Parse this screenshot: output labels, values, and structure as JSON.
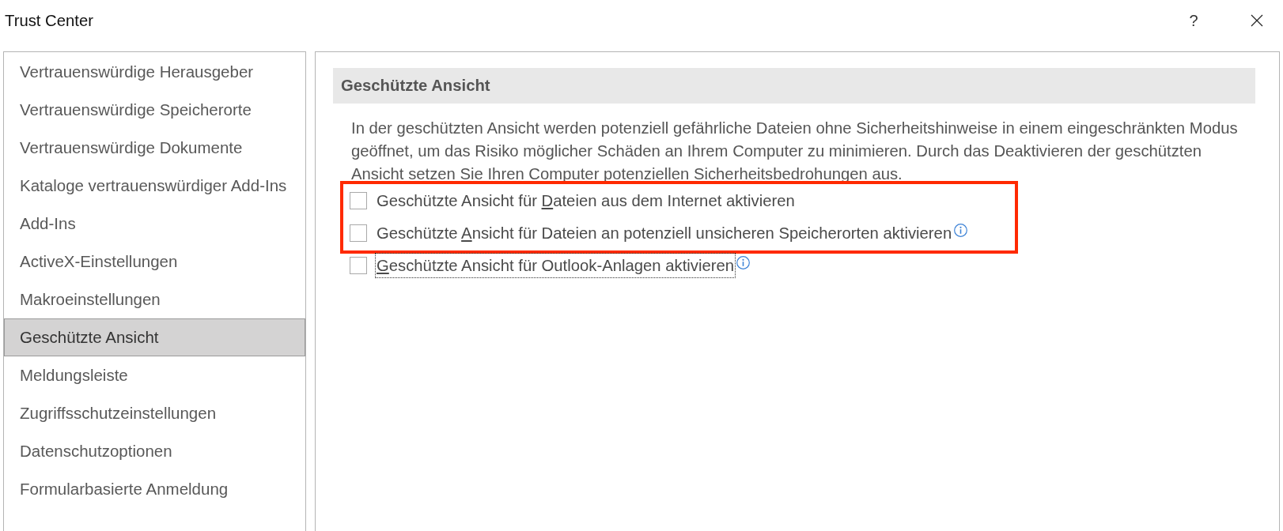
{
  "window": {
    "title": "Trust Center",
    "help": "?"
  },
  "sidebar": {
    "items": [
      {
        "label": "Vertrauenswürdige Herausgeber",
        "selected": false
      },
      {
        "label": "Vertrauenswürdige Speicherorte",
        "selected": false
      },
      {
        "label": "Vertrauenswürdige Dokumente",
        "selected": false
      },
      {
        "label": "Kataloge vertrauenswürdiger Add-Ins",
        "selected": false
      },
      {
        "label": "Add-Ins",
        "selected": false
      },
      {
        "label": "ActiveX-Einstellungen",
        "selected": false
      },
      {
        "label": "Makroeinstellungen",
        "selected": false
      },
      {
        "label": "Geschützte Ansicht",
        "selected": true
      },
      {
        "label": "Meldungsleiste",
        "selected": false
      },
      {
        "label": "Zugriffsschutzeinstellungen",
        "selected": false
      },
      {
        "label": "Datenschutzoptionen",
        "selected": false
      },
      {
        "label": "Formularbasierte Anmeldung",
        "selected": false
      }
    ]
  },
  "content": {
    "heading": "Geschützte Ansicht",
    "description": "In der geschützten Ansicht werden potenziell gefährliche Dateien ohne Sicherheitshinweise in einem eingeschränkten Modus geöffnet, um das Risiko möglicher Schäden an Ihrem Computer zu minimieren. Durch das Deaktivieren der geschützten Ansicht setzen Sie Ihren Computer potenziellen Sicherheitsbedrohungen aus.",
    "options": [
      {
        "label_before": "Geschützte Ansicht für ",
        "access_key": "D",
        "label_after": "ateien aus dem Internet aktivieren",
        "checked": false,
        "info": false,
        "focused": false,
        "highlighted": true
      },
      {
        "label_before": "Geschützte ",
        "access_key": "A",
        "label_after": "nsicht für Dateien an potenziell unsicheren Speicherorten aktivieren",
        "checked": false,
        "info": true,
        "focused": false,
        "highlighted": true
      },
      {
        "access_key": "G",
        "label_after": "eschützte Ansicht für Outlook-Anlagen aktivieren",
        "checked": false,
        "info": true,
        "focused": true,
        "highlighted": false
      }
    ]
  }
}
